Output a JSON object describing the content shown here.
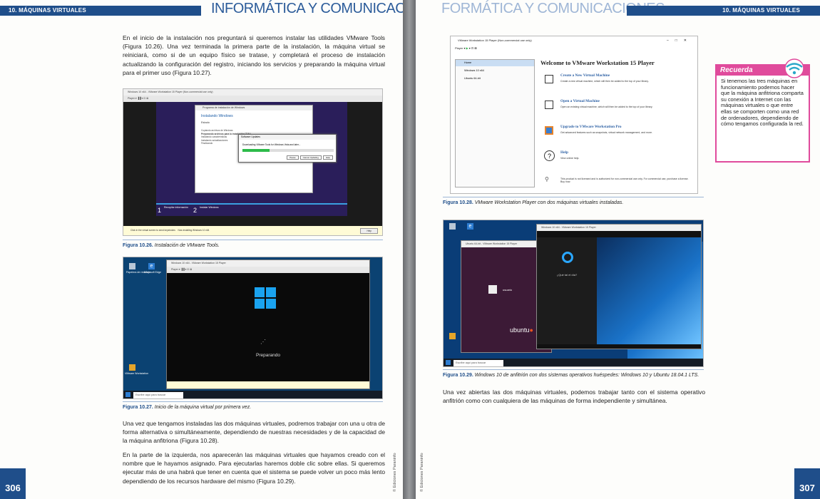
{
  "header": {
    "chapter": "10. MÁQUINAS VIRTUALES",
    "series_title": "INFORMÁTICA Y COMUNICACIONES",
    "series_title_right": "FORMÁTICA Y COMUNICACIONES"
  },
  "left_page": {
    "page_number": "306",
    "copyright": "© Ediciones Paraninfo",
    "para1": "En el inicio de la instalación nos preguntará si queremos instalar las utilidades VMware Tools (Figura 10.26). Una vez terminada la primera parte de la instalación, la máquina virtual se reiniciará, como si de un equipo físico se tratase, y completará el proceso de instalación actualizando la configuración del registro, iniciando los servicios y preparando la máquina virtual para el primer uso (Figura 10.27).",
    "fig26": {
      "number": "Figura 10.26.",
      "caption": "Instalación de VMware Tools.",
      "window_title": "Windows 10 x64 - VMware Workstation 15 Player (Non-commercial use only)",
      "setup_title": "Programa de instalación de Windows",
      "installing": "Instalando Windows",
      "status": "Estado",
      "steps": [
        "Copiando archivos de Windows",
        "Preparando archivos para la instalación (71%)",
        "Instalando características",
        "Instalando actualizaciones",
        "Finalizando"
      ],
      "dialog_title": "Software Updates",
      "dialog_text": "Downloading VMware Tools for Windows Vista and later...",
      "dialog_buttons": [
        "Pause",
        "Cancel Updating",
        "Help"
      ],
      "progress_steps": [
        "Recopilar información",
        "Instalar Windows"
      ],
      "bottom_text": "Click in the virtual screen to send keystrokes",
      "bottom_info": "Now installing Windows 10 x64",
      "help": "Help"
    },
    "fig27": {
      "number": "Figura 10.27.",
      "caption": "Inicio de la máquina virtual por primera vez.",
      "preparing": "Preparando",
      "search": "Escribe aquí para buscar",
      "desktop_icons": [
        "Papelera de reciclaje",
        "Microsoft Edge",
        "VMware Workstation"
      ]
    },
    "para2": "Una vez que tengamos instaladas las dos máquinas virtuales, podremos trabajar con una u otra de forma alternativa o simultáneamente, dependiendo de nuestras necesidades y de la capacidad de la máquina anfitriona (Figura 10.28).",
    "para3": "En la parte de la izquierda, nos aparecerán las máquinas virtuales que hayamos creado con el nombre que le hayamos asignado. Para ejecutarlas haremos doble clic sobre ellas. Si queremos ejecutar más de una habrá que tener en cuenta que el sistema se puede volver un poco más lento dependiendo de los recursos hardware del mismo (Figura 10.29)."
  },
  "right_page": {
    "page_number": "307",
    "copyright": "© Ediciones Paraninfo",
    "fig28": {
      "number": "Figura 10.28.",
      "caption": "VMware Workstation Player con dos máquinas virtuales instaladas.",
      "window_title": "VMware Workstation 15 Player (Non-commercial use only)",
      "player_menu": "Player ▾",
      "vm_list": [
        "Home",
        "Windows 10 x64",
        "Ubuntu 64-bit"
      ],
      "welcome": "Welcome to VMware Workstation 15 Player",
      "actions": [
        {
          "title": "Create a New Virtual Machine",
          "desc": "Create a new virtual machine, which will then be added to the top of your library."
        },
        {
          "title": "Open a Virtual Machine",
          "desc": "Open an existing virtual machine, which will then be added to the top of your library."
        },
        {
          "title": "Upgrade to VMware Workstation Pro",
          "desc": "Get advanced features such as snapshots, virtual network management, and more."
        },
        {
          "title": "Help",
          "desc": "View online help."
        }
      ],
      "license": "This product is not licensed and is authorized for non-commercial use only. For commercial use, purchase a license. Buy now."
    },
    "fig29": {
      "number": "Figura 10.29.",
      "caption": "Windows 10 de anfitrión con dos sistemas operativos huéspedes: Windows 10 y Ubuntu 18.04.1 LTS.",
      "ubuntu": "ubuntu",
      "user": "usuario",
      "cortana": "¿Qué tal el día?",
      "search": "Escribe aquí para buscar"
    },
    "para1": "Una vez abiertas las dos máquinas virtuales, podemos trabajar tanto con el sistema operativo anfitrión como con cualquiera de las máquinas de forma independiente y simultánea.",
    "recuerda": {
      "title": "Recuerda",
      "text": "Si tenemos las tres máquinas en funcionamiento podemos hacer que la máquina anfitriona comparta su conexión a Internet con las máquinas virtuales o que entre ellas se comporten como una red de ordenadores, dependiendo de cómo tengamos configurada la red."
    }
  },
  "colors": {
    "brand_blue": "#1f4e8a",
    "accent_pink": "#e04b9c"
  }
}
